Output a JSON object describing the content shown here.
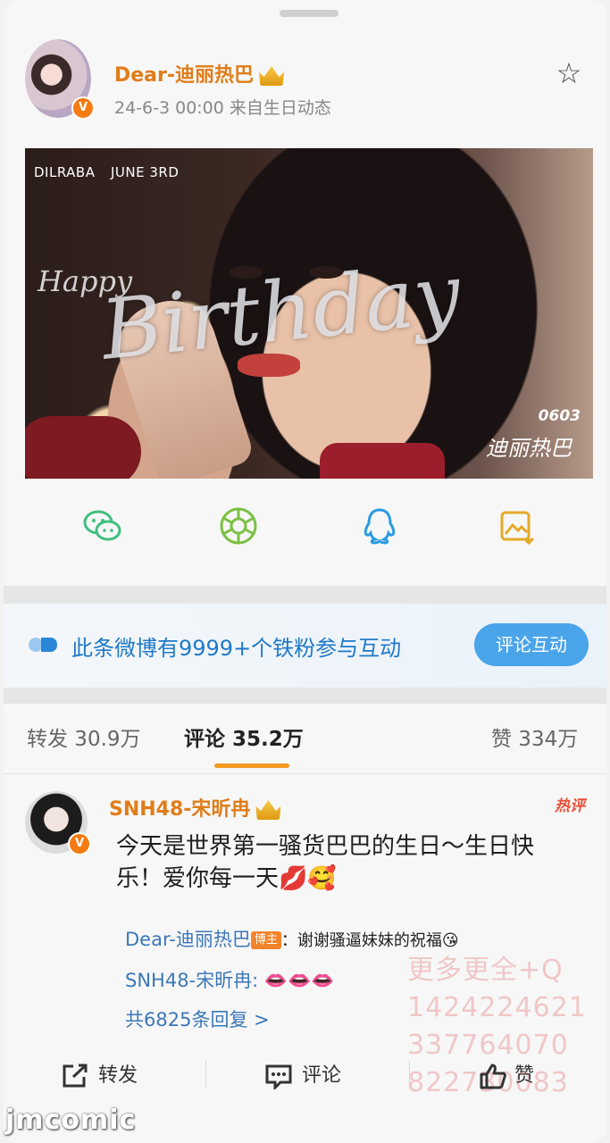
{
  "post": {
    "author": "Dear-迪丽热巴",
    "meta": "24-6-3 00:00  来自生日动态",
    "avatar_badge": "V",
    "image_text": {
      "tag_left": "DILRABA",
      "tag_right": "JUNE 3RD",
      "happy": "Happy",
      "script": "Birthday",
      "code": "0603",
      "signature": "迪丽热巴"
    }
  },
  "share_icons": [
    "wechat-icon",
    "moments-icon",
    "qq-icon",
    "save-image-icon"
  ],
  "fans_banner": {
    "text": "此条微博有9999+个铁粉参与互动",
    "button": "评论互动"
  },
  "tabs": {
    "repost": "转发 30.9万",
    "comments": "评论 35.2万",
    "likes": "赞 334万"
  },
  "comment": {
    "author": "SNH48-宋昕冉",
    "hot_label": "热评",
    "text": "今天是世界第一骚货巴巴的生日～生日快乐！爱你每一天💋🥰",
    "replies": [
      {
        "author": "Dear-迪丽热巴",
        "badge": "博主",
        "text": "：谢谢骚逼妹妹的祝福😘"
      },
      {
        "author": "SNH48-宋昕冉:",
        "text": "👄👄👄"
      }
    ],
    "more_replies": "共6825条回复 >"
  },
  "watermark_lines": [
    "更多更全+Q",
    "1424224621",
    "337764070",
    "822730083"
  ],
  "actions": {
    "repost": "转发",
    "comment": "评论",
    "like": "赞"
  },
  "site_logo": "jmcomic",
  "colors": {
    "accent_orange": "#e07d1a",
    "link_blue": "#3c78b8",
    "button_blue": "#4aa4ea",
    "tab_underline": "#f59a23"
  }
}
